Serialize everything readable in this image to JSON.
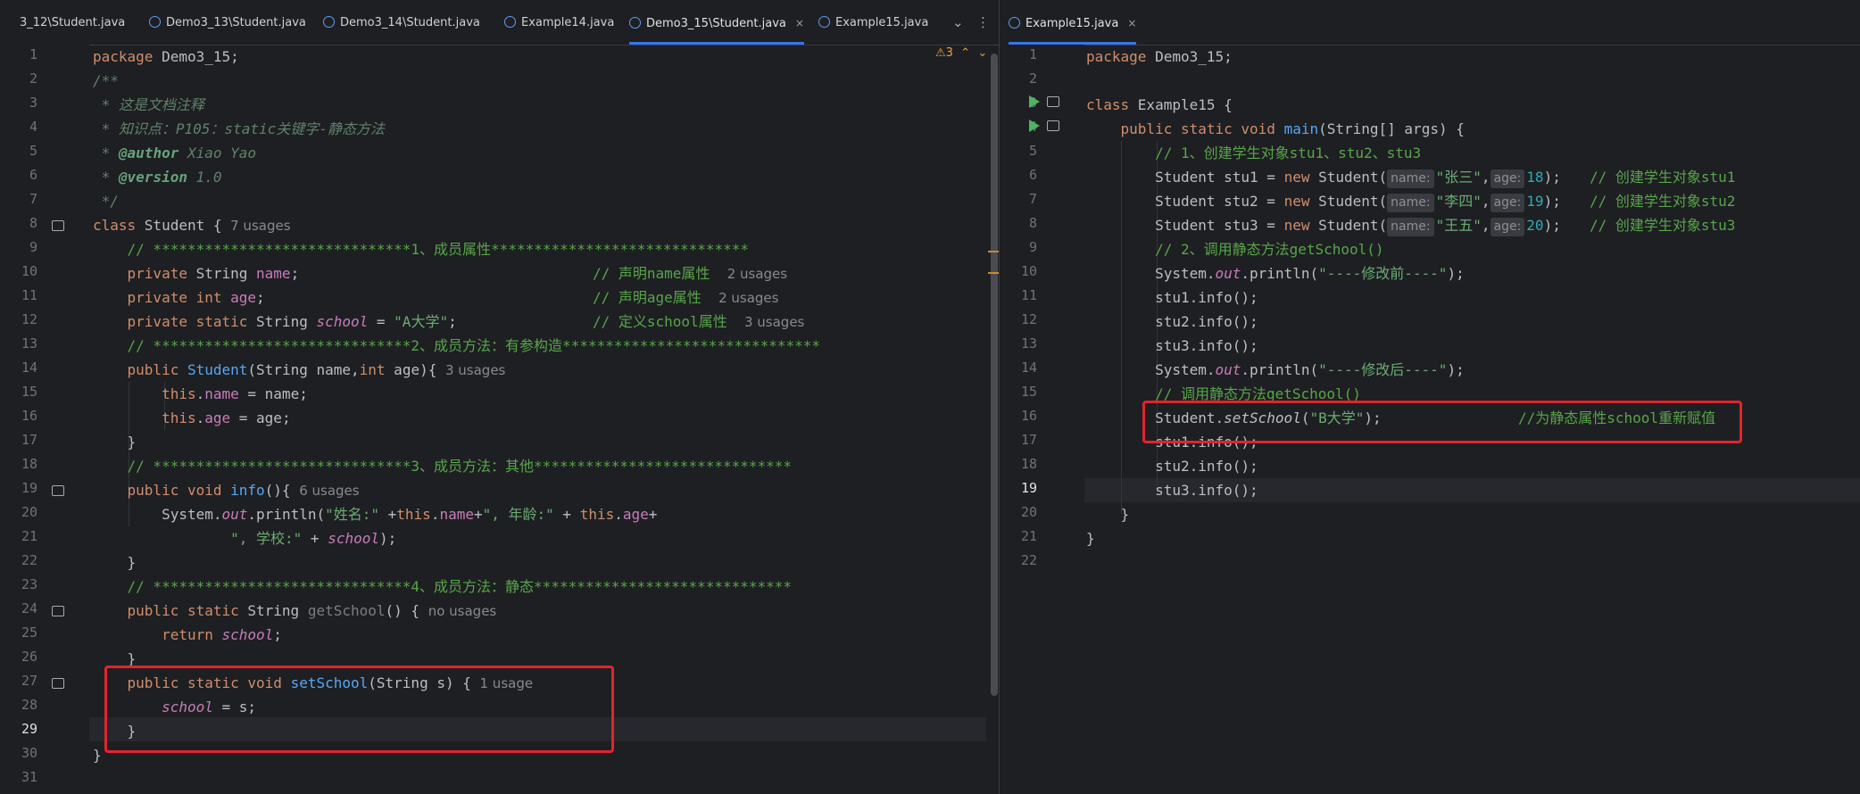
{
  "left_tabs": [
    {
      "label": "3_12\\Student.java",
      "active": false
    },
    {
      "label": "Demo3_13\\Student.java",
      "active": false
    },
    {
      "label": "Demo3_14\\Student.java",
      "active": false
    },
    {
      "label": "Example14.java",
      "active": false
    },
    {
      "label": "Demo3_15\\Student.java",
      "active": true
    },
    {
      "label": "Example15.java",
      "active": false
    }
  ],
  "right_tabs": [
    {
      "label": "Example15.java",
      "active": true
    }
  ],
  "tab_close_glyph": "×",
  "tab_menu_glyph": "⌄",
  "tab_more_glyph": "⋮",
  "inspection": {
    "count": "3",
    "up": "⌃",
    "down": "⌄"
  },
  "left_line_numbers": [
    "1",
    "2",
    "3",
    "4",
    "5",
    "6",
    "7",
    "8",
    "9",
    "10",
    "11",
    "12",
    "13",
    "14",
    "15",
    "16",
    "17",
    "18",
    "19",
    "20",
    "21",
    "22",
    "23",
    "24",
    "25",
    "26",
    "27",
    "28",
    "29",
    "30",
    "31"
  ],
  "right_line_numbers": [
    "1",
    "2",
    "3",
    "4",
    "5",
    "6",
    "7",
    "8",
    "9",
    "10",
    "11",
    "12",
    "13",
    "14",
    "15",
    "16",
    "17",
    "18",
    "19",
    "20",
    "21",
    "22"
  ],
  "left_code": {
    "l1": {
      "kw": "package ",
      "t": "Demo3_15;"
    },
    "l2": "/**",
    "l3": " * 这是文档注释",
    "l4": " * 知识点：P105：static关键字-静态方法",
    "l5": {
      "pre": " * ",
      "tag": "@author",
      "post": " Xiao Yao"
    },
    "l6": {
      "pre": " * ",
      "tag": "@version",
      "post": " 1.0"
    },
    "l7": " */",
    "l8": {
      "kw": "class ",
      "t": "Student { ",
      "usage": "7 usages"
    },
    "l9": "    // ******************************1、成员属性******************************",
    "l10": {
      "kw": "    private ",
      "t1": "String ",
      "f": "name",
      "t2": ";",
      "cm": "// 声明name属性",
      "usage": "2 usages"
    },
    "l11": {
      "kw": "    private int ",
      "f": "age",
      "t2": ";",
      "cm": "// 声明age属性",
      "usage": "2 usages"
    },
    "l12": {
      "kw": "    private static ",
      "t1": "String ",
      "f": "school",
      "t2": " = ",
      "s": "\"A大学\"",
      "t3": ";",
      "cm": "// 定义school属性",
      "usage": "3 usages"
    },
    "l13": "    // ******************************2、成员方法：有参构造******************************",
    "l14": {
      "kw": "    public ",
      "fn": "Student",
      "t1": "(String name,",
      "kw2": "int",
      "t2": " age){ ",
      "usage": "3 usages"
    },
    "l15": {
      "kw": "        this",
      "t1": ".",
      "f": "name",
      "t2": " = name;"
    },
    "l16": {
      "kw": "        this",
      "t1": ".",
      "f": "age",
      "t2": " = age;"
    },
    "l17": "    }",
    "l18": "    // ******************************3、成员方法：其他******************************",
    "l19": {
      "kw": "    public void ",
      "fn": "info",
      "t1": "(){ ",
      "usage": "6 usages"
    },
    "l20": {
      "t1": "        System.",
      "sf": "out",
      "t2": ".println(",
      "s1": "\"姓名:\"",
      "t3": " +",
      "kw": "this",
      "t4": ".",
      "f1": "name",
      "t5": "+",
      "s2": "\", 年龄:\"",
      "t6": " + ",
      "kw2": "this",
      "t7": ".",
      "f2": "age",
      "t8": "+"
    },
    "l21": {
      "t1": "                ",
      "s": "\", 学校:\"",
      "t2": " + ",
      "sf": "school",
      "t3": ");"
    },
    "l22": "    }",
    "l23": "    // ******************************4、成员方法：静态******************************",
    "l24": {
      "kw": "    public static ",
      "t1": "String ",
      "fn": "getSchool",
      "t2": "() { ",
      "usage": "no usages"
    },
    "l25": {
      "kw": "        return ",
      "sf": "school",
      "t1": ";"
    },
    "l26": "    }",
    "l27": {
      "kw": "    public static void ",
      "fn": "setSchool",
      "t1": "(String s) { ",
      "usage": "1 usage"
    },
    "l28": {
      "t0": "        ",
      "sf": "school",
      "t1": " = s;"
    },
    "l29": "    }",
    "l30": "}",
    "l31": ""
  },
  "right_code": {
    "l1": {
      "kw": "package ",
      "t": "Demo3_15;"
    },
    "l2": "",
    "l3": {
      "kw": "class ",
      "t": "Example15 {"
    },
    "l4": {
      "kw": "    public static void ",
      "fn": "main",
      "t1": "(String[] args) {"
    },
    "l5": "        // 1、创建学生对象stu1、stu2、stu3",
    "l6": {
      "t1": "        Student stu1 = ",
      "kw": "new ",
      "t2": "Student(",
      "h1": "name:",
      "s": "\"张三\"",
      "t3": ",",
      "h2": "age:",
      "n": "18",
      "t4": ");",
      "cm": "// 创建学生对象stu1"
    },
    "l7": {
      "t1": "        Student stu2 = ",
      "kw": "new ",
      "t2": "Student(",
      "h1": "name:",
      "s": "\"李四\"",
      "t3": ",",
      "h2": "age:",
      "n": "19",
      "t4": ");",
      "cm": "// 创建学生对象stu2"
    },
    "l8": {
      "t1": "        Student stu3 = ",
      "kw": "new ",
      "t2": "Student(",
      "h1": "name:",
      "s": "\"王五\"",
      "t3": ",",
      "h2": "age:",
      "n": "20",
      "t4": ");",
      "cm": "// 创建学生对象stu3"
    },
    "l9": "        // 2、调用静态方法getSchool()",
    "l10": {
      "t1": "        System.",
      "sf": "out",
      "t2": ".println(",
      "s": "\"----修改前----\"",
      "t3": ");"
    },
    "l11": "        stu1.info();",
    "l12": "        stu2.info();",
    "l13": "        stu3.info();",
    "l14": {
      "t1": "        System.",
      "sf": "out",
      "t2": ".println(",
      "s": "\"----修改后----\"",
      "t3": ");"
    },
    "l15": "        // 调用静态方法getSchool()",
    "l16": {
      "t1": "        Student.",
      "sm": "setSchool",
      "t2": "(",
      "s": "\"B大学\"",
      "t3": ");",
      "cm": "//为静态属性school重新赋值"
    },
    "l17": "        stu1.info();",
    "l18": "        stu2.info();",
    "l19": "        stu3.info();",
    "l20": "    }",
    "l21": "}",
    "l22": ""
  }
}
